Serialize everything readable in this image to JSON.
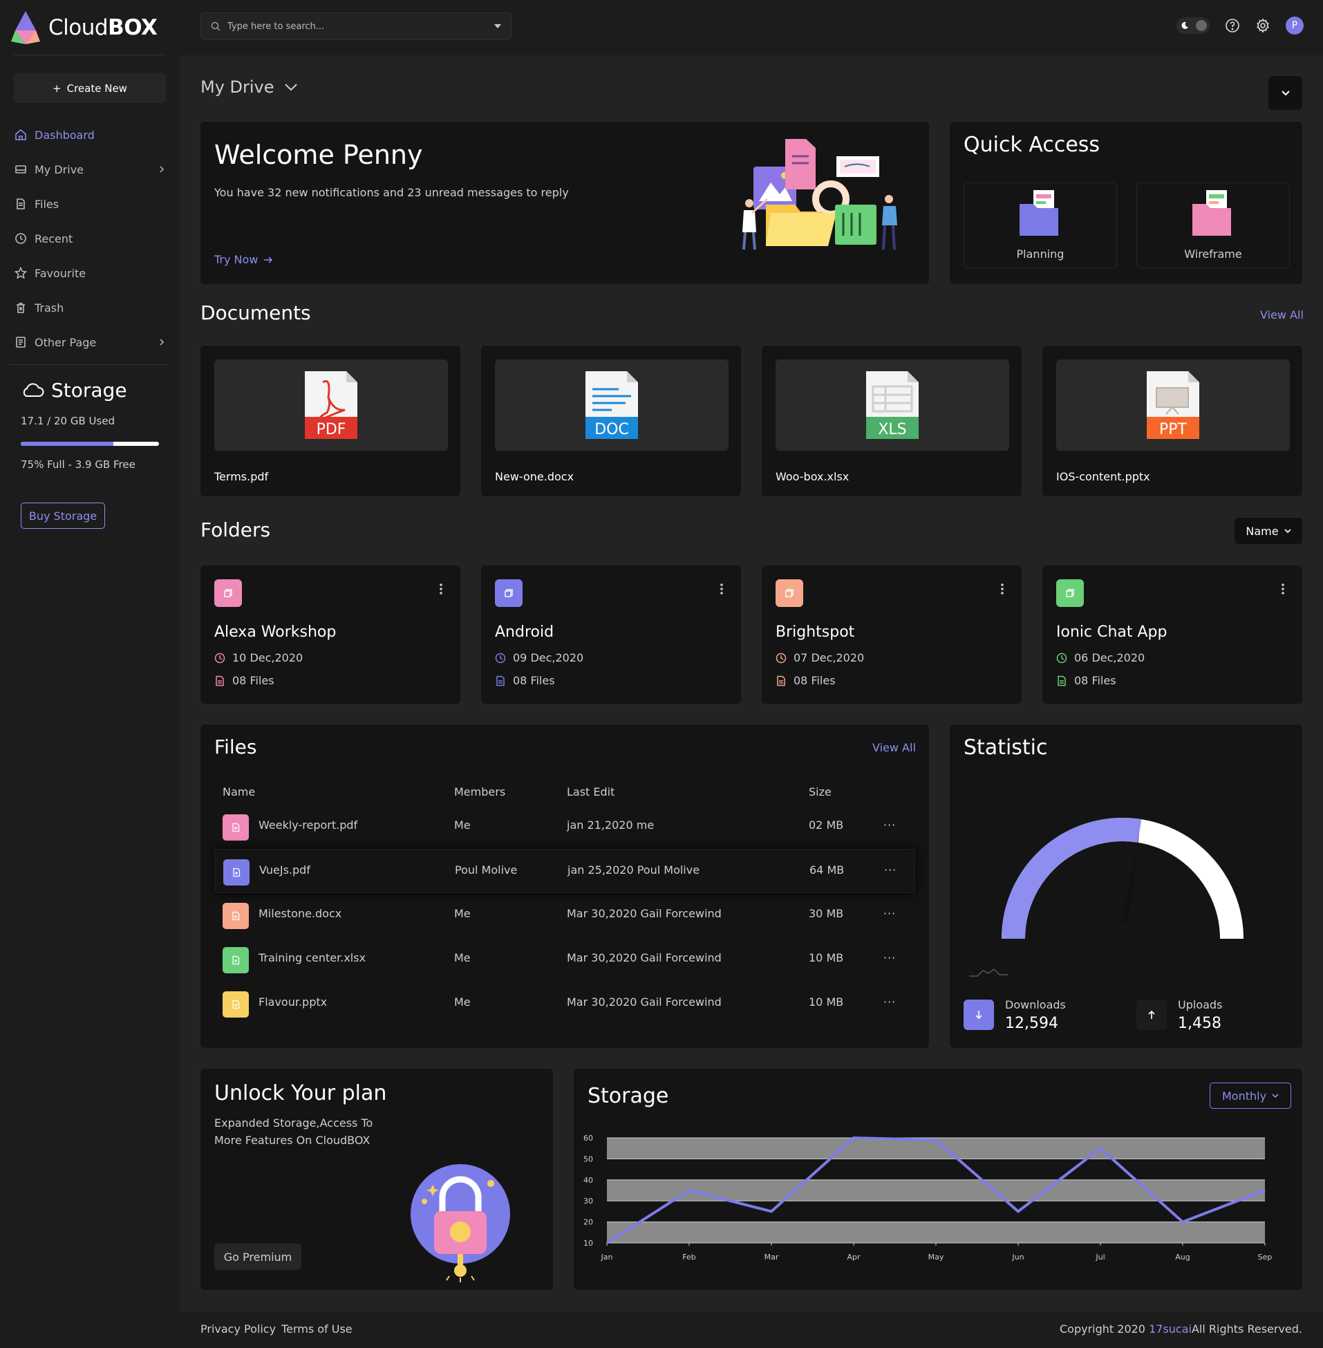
{
  "app": {
    "logo_prefix": "Cloud",
    "logo_bold": "BOX"
  },
  "sidebar": {
    "create_label": "Create New",
    "items": [
      {
        "label": "Dashboard",
        "icon": "home-icon",
        "active": true
      },
      {
        "label": "My Drive",
        "icon": "drive-icon",
        "chevron": true
      },
      {
        "label": "Files",
        "icon": "file-icon"
      },
      {
        "label": "Recent",
        "icon": "clock-icon"
      },
      {
        "label": "Favourite",
        "icon": "star-icon"
      },
      {
        "label": "Trash",
        "icon": "trash-icon"
      },
      {
        "label": "Other Page",
        "icon": "page-icon",
        "chevron": true
      }
    ],
    "storage": {
      "title": "Storage",
      "used": "17.1 / 20 GB Used",
      "used_fraction": 0.67,
      "free": "75% Full - 3.9 GB Free",
      "buy_label": "Buy Storage"
    }
  },
  "header": {
    "search_placeholder": "Type here to search...",
    "avatar_initial": "P"
  },
  "main": {
    "page_title": "My Drive",
    "welcome": {
      "title": "Welcome Penny",
      "text": "You have 32 new notifications and 23 unread messages to reply",
      "cta": "Try Now"
    },
    "quick_access": {
      "title": "Quick Access",
      "items": [
        {
          "label": "Planning",
          "color": "#7c7ce8"
        },
        {
          "label": "Wireframe",
          "color": "#f08ab8"
        }
      ]
    },
    "documents": {
      "title": "Documents",
      "view_all": "View All",
      "items": [
        {
          "name": "Terms.pdf",
          "type": "PDF",
          "color": "#e0352b"
        },
        {
          "name": "New-one.docx",
          "type": "DOC",
          "color": "#1a8ad8"
        },
        {
          "name": "Woo-box.xlsx",
          "type": "XLS",
          "color": "#4caf6a"
        },
        {
          "name": "IOS-content.pptx",
          "type": "PPT",
          "color": "#f7672a"
        }
      ]
    },
    "folders": {
      "title": "Folders",
      "sort_label": "Name",
      "items": [
        {
          "name": "Alexa Workshop",
          "date": "10 Dec,2020",
          "files": "08 Files",
          "color": "#f08ab8"
        },
        {
          "name": "Android",
          "date": "09 Dec,2020",
          "files": "08 Files",
          "color": "#7c7ce8"
        },
        {
          "name": "Brightspot",
          "date": "07 Dec,2020",
          "files": "08 Files",
          "color": "#f7a88a"
        },
        {
          "name": "Ionic Chat App",
          "date": "06 Dec,2020",
          "files": "08 Files",
          "color": "#6ad07a"
        }
      ]
    },
    "files": {
      "title": "Files",
      "view_all": "View All",
      "columns": [
        "Name",
        "Members",
        "Last Edit",
        "Size"
      ],
      "rows": [
        {
          "name": "Weekly-report.pdf",
          "members": "Me",
          "edit": "jan 21,2020 me",
          "size": "02 MB",
          "color": "#f08ab8"
        },
        {
          "name": "VueJs.pdf",
          "members": "Poul Molive",
          "edit": "jan 25,2020 Poul Molive",
          "size": "64 MB",
          "color": "#7c7ce8"
        },
        {
          "name": "Milestone.docx",
          "members": "Me",
          "edit": "Mar 30,2020 Gail Forcewind",
          "size": "30 MB",
          "color": "#f7a88a"
        },
        {
          "name": "Training center.xlsx",
          "members": "Me",
          "edit": "Mar 30,2020 Gail Forcewind",
          "size": "10 MB",
          "color": "#6ad07a"
        },
        {
          "name": "Flavour.pptx",
          "members": "Me",
          "edit": "Mar 30,2020 Gail Forcewind",
          "size": "10 MB",
          "color": "#f7d060"
        }
      ],
      "row_action": "···"
    },
    "statistic": {
      "title": "Statistic",
      "gauge_fraction": 0.55,
      "downloads_label": "Downloads",
      "downloads_value": "12,594",
      "uploads_label": "Uploads",
      "uploads_value": "1,458"
    },
    "unlock": {
      "title": "Unlock Your plan",
      "text": "Expanded Storage,Access To More Features On CloudBOX",
      "cta": "Go Premium"
    },
    "storage_chart": {
      "title": "Storage",
      "period": "Monthly"
    }
  },
  "chart_data": {
    "type": "line",
    "categories": [
      "Jan",
      "Feb",
      "Mar",
      "Apr",
      "May",
      "Jun",
      "Jul",
      "Aug",
      "Sep"
    ],
    "values": [
      10,
      35,
      25,
      60,
      59,
      25,
      55,
      20,
      35
    ],
    "ylim": [
      10,
      60
    ],
    "yticks": [
      10,
      20,
      30,
      40,
      50,
      60
    ],
    "grid": true,
    "color": "#7c7ce8"
  },
  "footer": {
    "privacy": "Privacy Policy",
    "terms": "Terms of Use",
    "copyright_prefix": "Copyright 2020 ",
    "brand": "17sucai",
    "copyright_suffix": "All Rights Reserved."
  }
}
